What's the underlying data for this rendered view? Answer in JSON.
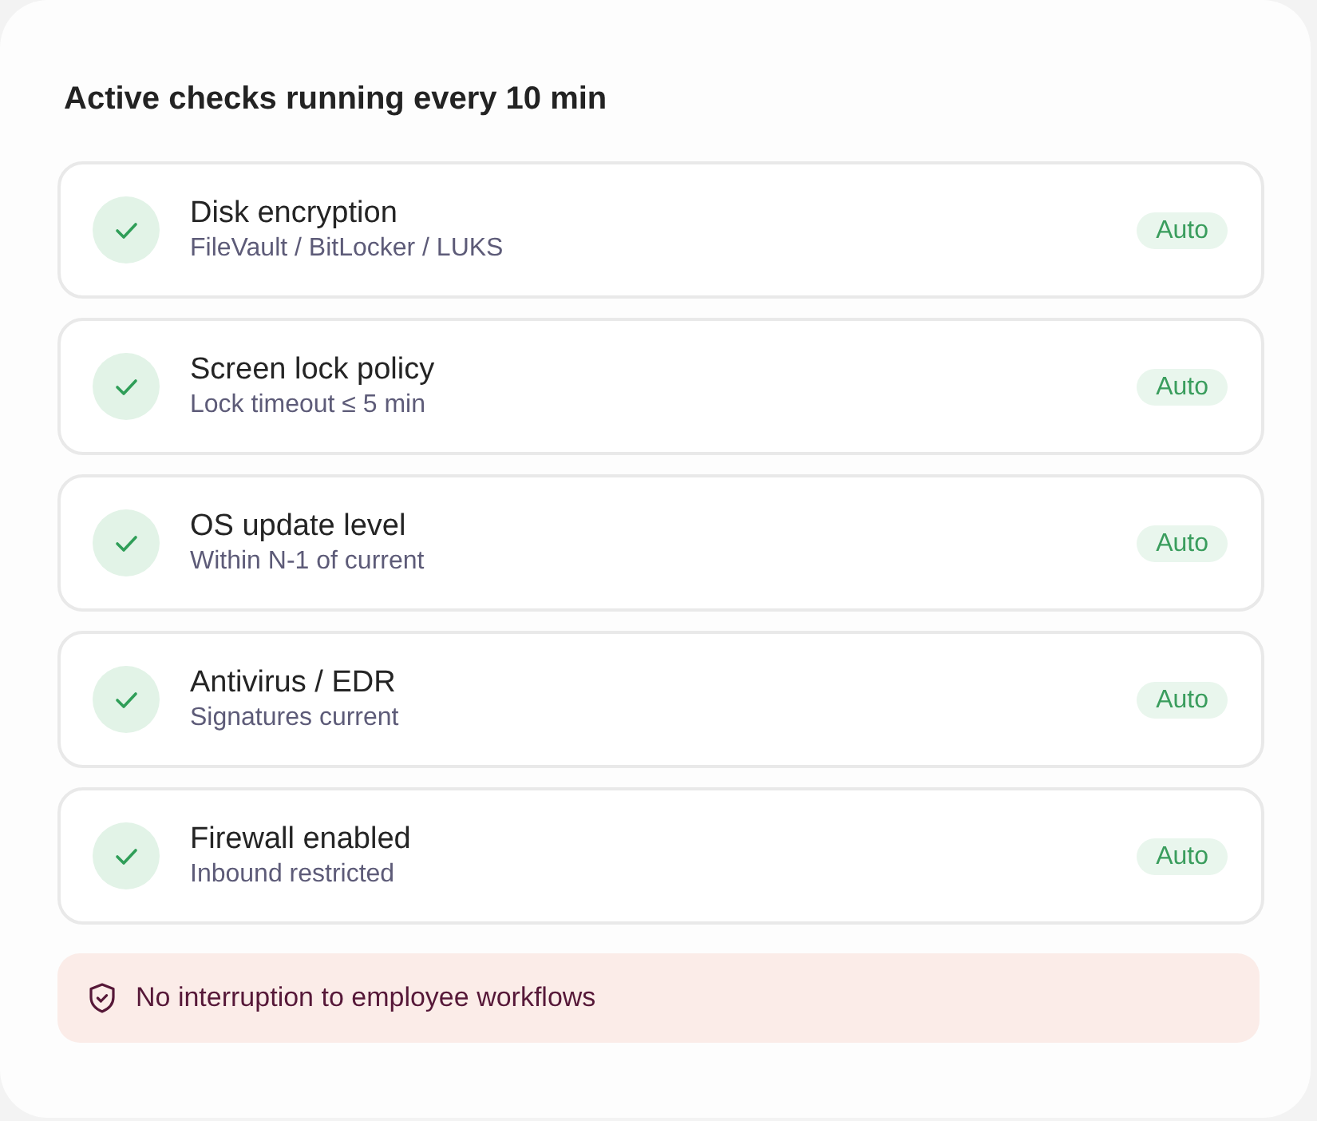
{
  "heading": "Active checks running every 10 min",
  "checks": [
    {
      "title": "Disk encryption",
      "detail": "FileVault / BitLocker / LUKS",
      "passed": true,
      "badge": "Auto"
    },
    {
      "title": "Screen lock policy",
      "detail": "Lock timeout ≤ 5 min",
      "passed": true,
      "badge": "Auto"
    },
    {
      "title": "OS update level",
      "detail": "Within N-1 of current",
      "passed": true,
      "badge": "Auto"
    },
    {
      "title": "Antivirus / EDR",
      "detail": "Signatures current",
      "passed": true,
      "badge": "Auto"
    },
    {
      "title": "Firewall enabled",
      "detail": "Inbound restricted",
      "passed": true,
      "badge": "Auto"
    }
  ],
  "notice": {
    "text": "No interruption to employee workflows"
  }
}
